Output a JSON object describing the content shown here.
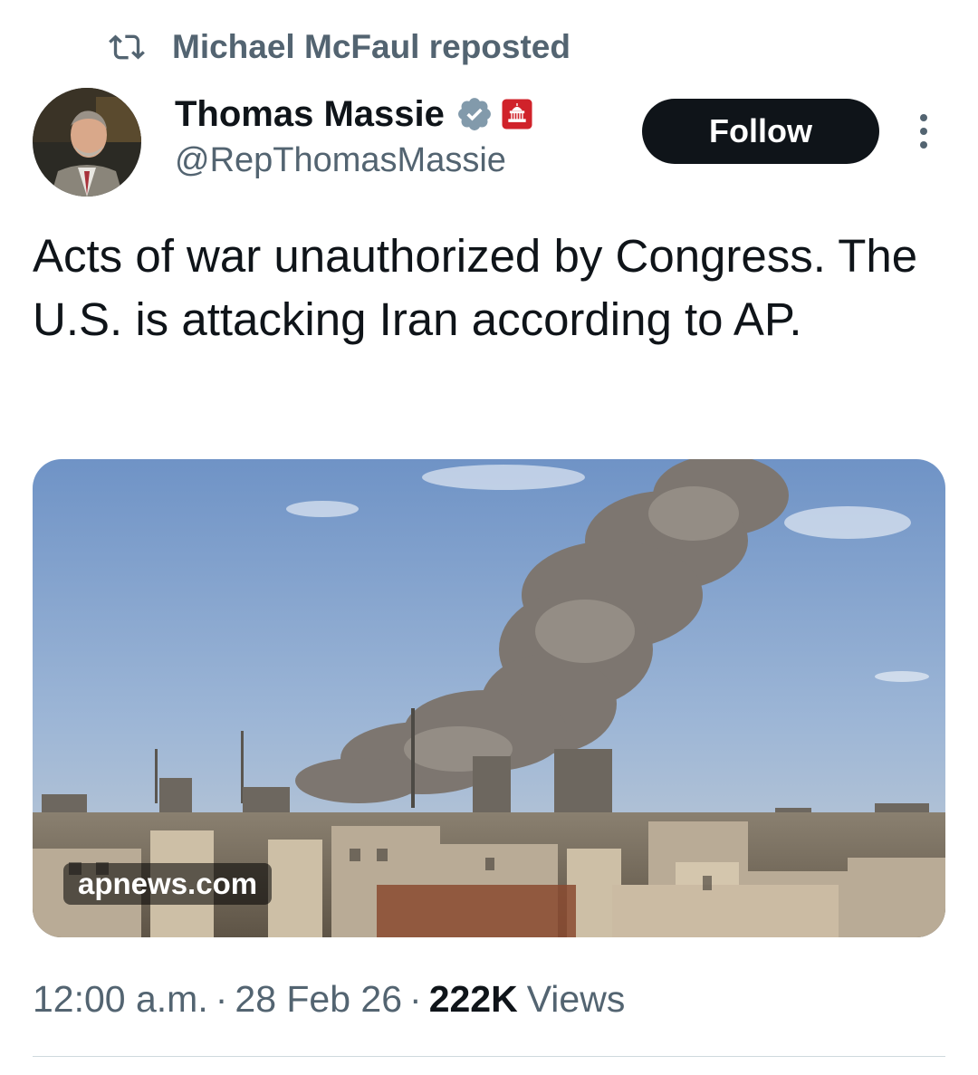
{
  "repost": {
    "icon": "repost-icon",
    "text": "Michael McFaul reposted"
  },
  "author": {
    "name": "Thomas Massie",
    "handle": "@RepThomasMassie",
    "verified_icon": "verified-badge-icon",
    "affiliation_icon": "us-capitol-icon"
  },
  "follow_label": "Follow",
  "tweet": {
    "text": "Acts of war unauthorized by Congress. The U.S. is attacking Iran according to AP."
  },
  "media": {
    "link_label": "apnews.com"
  },
  "meta": {
    "time": "12:00 a.m.",
    "separator": "·",
    "date": "28 Feb 26",
    "views_count": "222K",
    "views_label": "Views"
  },
  "colors": {
    "text": "#0f1419",
    "secondary": "#536471",
    "verified": "#829aab",
    "badge_red": "#d0222a",
    "button": "#0f1419"
  }
}
